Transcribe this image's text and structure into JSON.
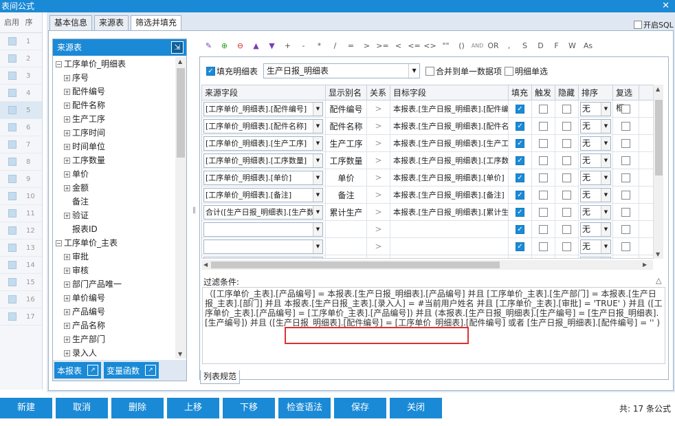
{
  "window": {
    "title": "表间公式"
  },
  "left_grid": {
    "headers": [
      "启用",
      "序"
    ],
    "rows": [
      "1",
      "2",
      "3",
      "4",
      "5",
      "6",
      "7",
      "8",
      "9",
      "10",
      "11",
      "12",
      "13",
      "14",
      "15",
      "16",
      "17"
    ]
  },
  "tabs": [
    "基本信息",
    "来源表",
    "筛选并填充"
  ],
  "sql_toggle": "开启SQL",
  "source_panel": {
    "title": "来源表",
    "footer_report": "本报表",
    "footer_var": "变量函数"
  },
  "tree": [
    {
      "label": "工序单价_明细表",
      "level": 0,
      "pm": "-"
    },
    {
      "label": "序号",
      "level": 1,
      "pm": "+"
    },
    {
      "label": "配件编号",
      "level": 1,
      "pm": "+"
    },
    {
      "label": "配件名称",
      "level": 1,
      "pm": "+"
    },
    {
      "label": "生产工序",
      "level": 1,
      "pm": "+"
    },
    {
      "label": "工序时间",
      "level": 1,
      "pm": "+"
    },
    {
      "label": "时间单位",
      "level": 1,
      "pm": "+"
    },
    {
      "label": "工序数量",
      "level": 1,
      "pm": "+"
    },
    {
      "label": "单价",
      "level": 1,
      "pm": "+"
    },
    {
      "label": "金额",
      "level": 1,
      "pm": "+"
    },
    {
      "label": "备注",
      "level": 2,
      "pm": ""
    },
    {
      "label": "验证",
      "level": 1,
      "pm": "+"
    },
    {
      "label": "报表ID",
      "level": 2,
      "pm": ""
    },
    {
      "label": "工序单价_主表",
      "level": 0,
      "pm": "-"
    },
    {
      "label": "审批",
      "level": 1,
      "pm": "+"
    },
    {
      "label": "审核",
      "level": 1,
      "pm": "+"
    },
    {
      "label": "部门产品唯一",
      "level": 1,
      "pm": "+"
    },
    {
      "label": "单价编号",
      "level": 1,
      "pm": "+"
    },
    {
      "label": "产品编号",
      "level": 1,
      "pm": "+"
    },
    {
      "label": "产品名称",
      "level": 1,
      "pm": "+"
    },
    {
      "label": "生产部门",
      "level": 1,
      "pm": "+"
    },
    {
      "label": "录入人",
      "level": 1,
      "pm": "+"
    }
  ],
  "toolbar": [
    "+",
    "-",
    "*",
    "/",
    "=",
    ">",
    ">=",
    "<",
    "<=",
    "<>",
    "\"\"",
    "()",
    "AND",
    "OR",
    ",",
    "S",
    "D",
    "F",
    "W",
    "As"
  ],
  "options": {
    "fill_detail_label": "填充明细表",
    "fill_detail_checked": true,
    "target_table": "生产日报_明细表",
    "merge_label": "合并到单一数据项",
    "detail_single_label": "明细单选"
  },
  "grid": {
    "headers": [
      "来源字段",
      "显示别名",
      "关系",
      "目标字段",
      "填充",
      "触发",
      "隐藏",
      "排序",
      "复选框"
    ],
    "rows": [
      {
        "source": "[工序单价_明细表].[配件编号]",
        "alias": "配件编号",
        "rel": ">",
        "target": "本报表.[生产日报_明细表].[配件编号]",
        "fill": true,
        "sort": "无"
      },
      {
        "source": "[工序单价_明细表].[配件名称]",
        "alias": "配件名称",
        "rel": ">",
        "target": "本报表.[生产日报_明细表].[配件名称]",
        "fill": true,
        "sort": "无"
      },
      {
        "source": "[工序单价_明细表].[生产工序]",
        "alias": "生产工序",
        "rel": ">",
        "target": "本报表.[生产日报_明细表].[生产工序]",
        "fill": true,
        "sort": "无"
      },
      {
        "source": "[工序单价_明细表].[工序数量]",
        "alias": "工序数量",
        "rel": ">",
        "target": "本报表.[生产日报_明细表].[工序数量]",
        "fill": true,
        "sort": "无"
      },
      {
        "source": "[工序单价_明细表].[单价]",
        "alias": "单价",
        "rel": ">",
        "target": "本报表.[生产日报_明细表].[单价]",
        "fill": true,
        "sort": "无"
      },
      {
        "source": "[工序单价_明细表].[备注]",
        "alias": "备注",
        "rel": ">",
        "target": "本报表.[生产日报_明细表].[备注]",
        "fill": true,
        "sort": "无"
      },
      {
        "source": "合计([生产日报_明细表].[生产数量])",
        "alias": "累计生产",
        "rel": ">",
        "target": "本报表.[生产日报_明细表].[累计生产]",
        "fill": true,
        "sort": "无"
      },
      {
        "source": "",
        "alias": "",
        "rel": ">",
        "target": "",
        "fill": true,
        "sort": "无"
      },
      {
        "source": "",
        "alias": "",
        "rel": ">",
        "target": "",
        "fill": true,
        "sort": "无"
      },
      {
        "source": "",
        "alias": "",
        "rel": ">",
        "target": "",
        "fill": true,
        "sort": "无"
      }
    ]
  },
  "filter": {
    "label": "过滤条件:",
    "text": "（[工序单价_主表].[产品编号] = 本报表.[生产日报_明细表].[产品编号] 并且 [工序单价_主表].[生产部门] = 本报表.[生产日报_主表].[部门] 并且 本报表.[生产日报_主表].[录入人] = #当前用户姓名 并且 [工序单价_主表].[审批] = 'TRUE' ) 并且 ([工序单价_主表].[产品编号] = [工序单价_主表].[产品编号]) 并且 (本报表.[生产日报_明细表].[生产编号] = [生产日报_明细表].[生产编号]) 并且 ([生产日报_明细表].[配件编号] = [工序单价_明细表].[配件编号] 或者 [生产日报_明细表].[配件编号] = '' )"
  },
  "subtab": "列表规范",
  "buttons": [
    "新建",
    "取消",
    "删除",
    "上移",
    "下移",
    "检查语法",
    "保存",
    "关闭"
  ],
  "count": "共:  17 条公式"
}
